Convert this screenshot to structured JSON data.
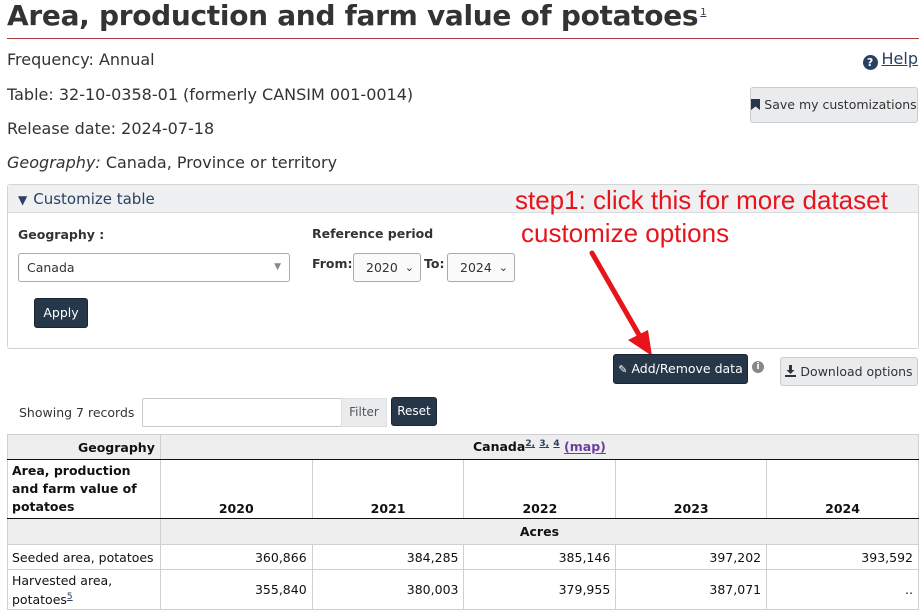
{
  "header": {
    "title": "Area, production and farm value of potatoes",
    "title_footnote": "1",
    "frequency": "Frequency: Annual",
    "table_id": "Table: 32-10-0358-01 (formerly CANSIM 001-0014)",
    "release_date": "Release date: 2024-07-18",
    "geography_label": "Geography:",
    "geography_value": " Canada, Province or territory",
    "help_label": "Help",
    "help_icon": "question-circle-icon",
    "accent_color": "#af3c43"
  },
  "toolbar": {
    "save_label": "Save my customizations",
    "save_icon": "bookmark-icon",
    "add_remove_label": "Add/Remove data",
    "add_remove_icon": "pencil-icon",
    "download_label": "Download options",
    "download_icon": "download-icon"
  },
  "customize": {
    "heading": "Customize table",
    "geography_label": "Geography :",
    "geography_value": "Canada",
    "reference_period_label": "Reference period",
    "from_label": "From:",
    "from_value": "2020",
    "to_label": "To:",
    "to_value": "2024",
    "apply_label": "Apply"
  },
  "annotation": {
    "line1": "step1: click this for more dataset",
    "line2": "customize options",
    "color": "#e8141c"
  },
  "filter": {
    "showing": "Showing 7 records",
    "input_value": "",
    "filter_label": "Filter",
    "reset_label": "Reset"
  },
  "table": {
    "geography_header": "Geography",
    "geography_value": "Canada",
    "geography_footnotes": [
      "2",
      "3",
      "4"
    ],
    "map_link": "(map)",
    "row_header": "Area, production and farm value of potatoes",
    "years": [
      "2020",
      "2021",
      "2022",
      "2023",
      "2024"
    ],
    "unit": "Acres",
    "rows": [
      {
        "label": "Seeded area, potatoes",
        "footnote": "",
        "values": [
          "360,866",
          "384,285",
          "385,146",
          "397,202",
          "393,592"
        ]
      },
      {
        "label": "Harvested area, potatoes",
        "footnote": "5",
        "values": [
          "355,840",
          "380,003",
          "379,955",
          "387,071",
          ".."
        ]
      }
    ]
  }
}
